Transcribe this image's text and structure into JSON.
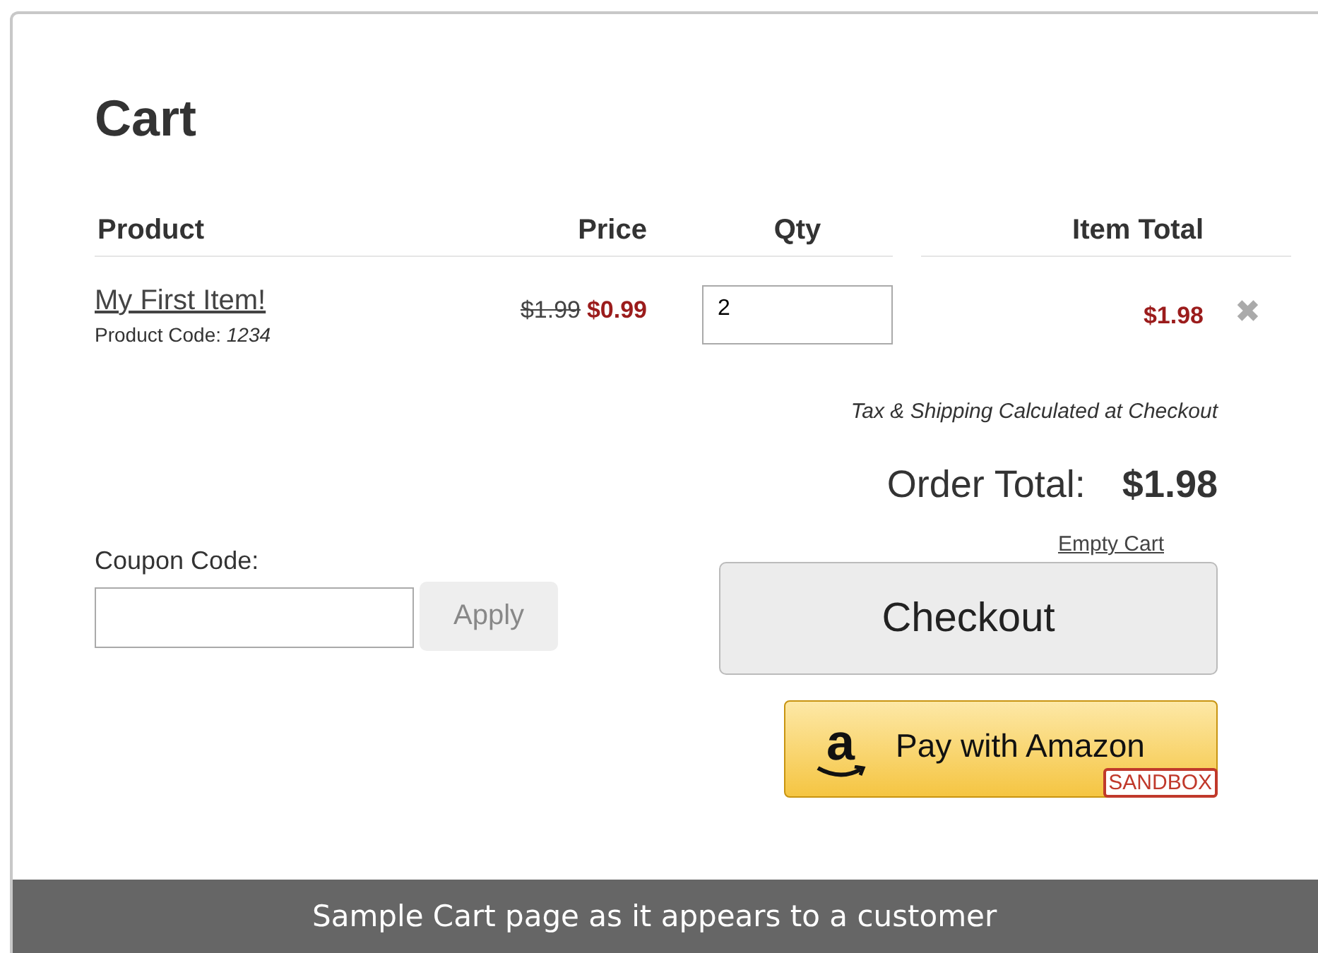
{
  "cart": {
    "title": "Cart",
    "columns": [
      "Product",
      "Price",
      "Qty",
      "Item Total"
    ],
    "items": [
      {
        "name": "My First Item!",
        "code_label": "Product Code:",
        "code": "1234",
        "old_price": "$1.99",
        "price": "$0.99",
        "qty": "2",
        "item_total": "$1.98",
        "remove": "✖"
      }
    ],
    "tax_note": "Tax & Shipping Calculated at Checkout",
    "order_total_label": "Order Total:",
    "order_total": "$1.98",
    "coupon": {
      "label": "Coupon Code:",
      "button": "Apply"
    },
    "empty_cart": "Empty Cart",
    "checkout": "Checkout",
    "amazon": {
      "logo_letter": "a",
      "label": "Pay with Amazon",
      "badge": "SANDBOX"
    }
  },
  "caption": "Sample Cart page as it appears to a customer"
}
